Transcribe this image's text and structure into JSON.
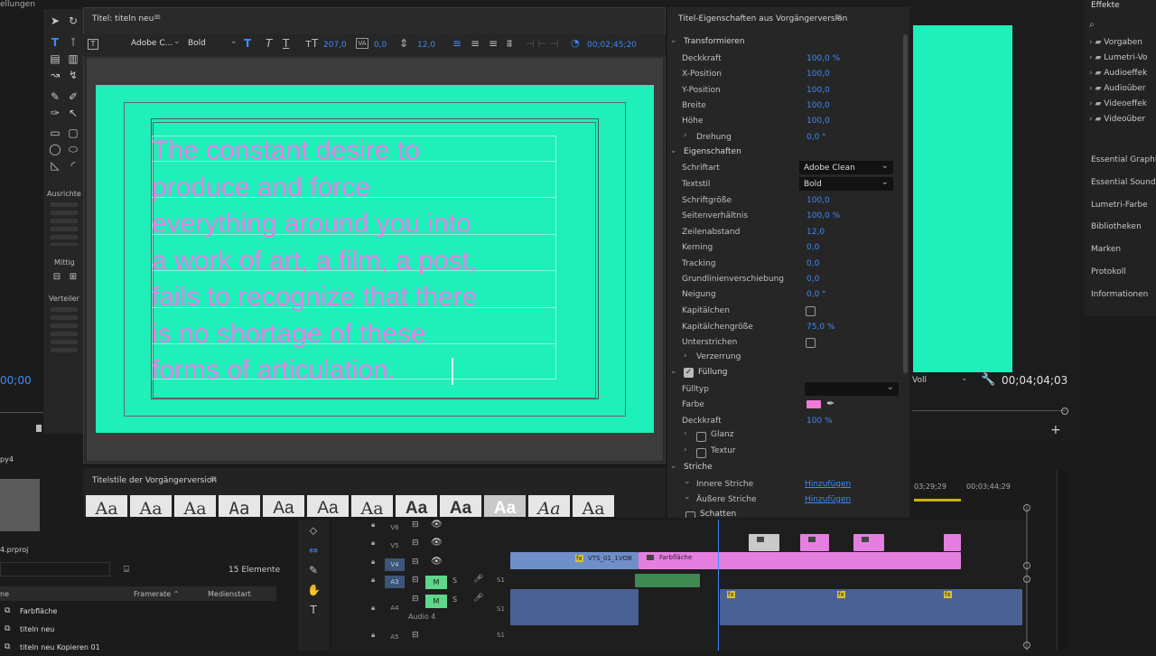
{
  "window": {
    "top_left_label": "ellungen"
  },
  "titler": {
    "tab_title": "Titel: titeln neu",
    "font_family": "Adobe C...",
    "font_style": "Bold",
    "font_size": "207,0",
    "kerning": "0,0",
    "leading": "12,0",
    "timecode": "00;02;45;20",
    "text": "The constant desire to\nproduce and force\neverything around you into\na work of art, a film, a post,\nfails to recognize that there\nis no shortage of these\nforms of articulation.",
    "background_color": "#1fefb9",
    "text_color": "#e67fe6"
  },
  "left_tools": {
    "align_label": "Ausrichte",
    "center_label": "Mittig",
    "distribute_label": "Verteiler"
  },
  "source_timecode": "00;00",
  "styles": {
    "header": "Titelstile der Vorgängerversion",
    "swatch_label": "Aa"
  },
  "props": {
    "header": "Titel-Eigenschaften aus Vorgängerversion",
    "transform_label": "Transformieren",
    "transform": [
      {
        "label": "Deckkraft",
        "value": "100,0 %"
      },
      {
        "label": "X-Position",
        "value": "100,0"
      },
      {
        "label": "Y-Position",
        "value": "100,0"
      },
      {
        "label": "Breite",
        "value": "100,0"
      },
      {
        "label": "Höhe",
        "value": "100,0"
      },
      {
        "label": "Drehung",
        "value": "0,0 °"
      }
    ],
    "properties_label": "Eigenschaften",
    "font_label": "Schriftart",
    "font_value": "Adobe Clean",
    "style_label": "Textstil",
    "style_value": "Bold",
    "properties": [
      {
        "label": "Schriftgröße",
        "value": "100,0"
      },
      {
        "label": "Seitenverhältnis",
        "value": "100,0 %"
      },
      {
        "label": "Zeilenabstand",
        "value": "12,0"
      },
      {
        "label": "Kerning",
        "value": "0,0"
      },
      {
        "label": "Tracking",
        "value": "0,0"
      },
      {
        "label": "Grundlinienverschiebung",
        "value": "0,0"
      },
      {
        "label": "Neigung",
        "value": "0,0 °"
      }
    ],
    "smallcaps_label": "Kapitälchen",
    "smallcaps_size_label": "Kapitälchengröße",
    "smallcaps_size_value": "75,0 %",
    "underline_label": "Unterstrichen",
    "distort_label": "Verzerrung",
    "fill_label": "Füllung",
    "fill_type_label": "Fülltyp",
    "color_label": "Farbe",
    "color_swatch": "#f07ad8",
    "fill_opacity_label": "Deckkraft",
    "fill_opacity_value": "100 %",
    "sheen_label": "Glanz",
    "texture_label": "Textur",
    "strokes_label": "Striche",
    "inner_strokes_label": "Innere Striche",
    "outer_strokes_label": "Äußere Striche",
    "add_label": "Hinzufügen",
    "shadow_label": "Schatten"
  },
  "program": {
    "fit": "Voll",
    "timecode": "00;04;04;03",
    "frame_color": "#1fefb9"
  },
  "effects": {
    "header": "Effekte",
    "items": [
      "Vorgaben",
      "Lumetri-Vo",
      "Audioeffek",
      "Audioüber",
      "Videoeffek",
      "Videoüber"
    ],
    "panels": [
      "Essential Graphics",
      "Essential Sound",
      "Lumetri-Farbe",
      "Bibliotheken",
      "Marken",
      "Protokoll",
      "Informationen"
    ]
  },
  "project": {
    "name_frag": "py4",
    "prproj": "4.prproj",
    "count": "15 Elemente",
    "col_framerate": "Framerate",
    "col_mediastart": "Medienstart",
    "col_name": "ne",
    "items": [
      "Farbfläche",
      "titeln neu",
      "titeln neu Kopieren 01"
    ]
  },
  "timeline": {
    "ruler": [
      "03;29;29",
      "00;03;44;29"
    ],
    "tracks_v": [
      "V6",
      "V5",
      "V4"
    ],
    "tracks_a": [
      "A3",
      "A4",
      "A5"
    ],
    "audio4_label": "Audio 4",
    "clip1": "VTS_01_1VOB",
    "clip2": "Farbfläche",
    "mute": "M",
    "solo": "S",
    "channel": "S1"
  }
}
